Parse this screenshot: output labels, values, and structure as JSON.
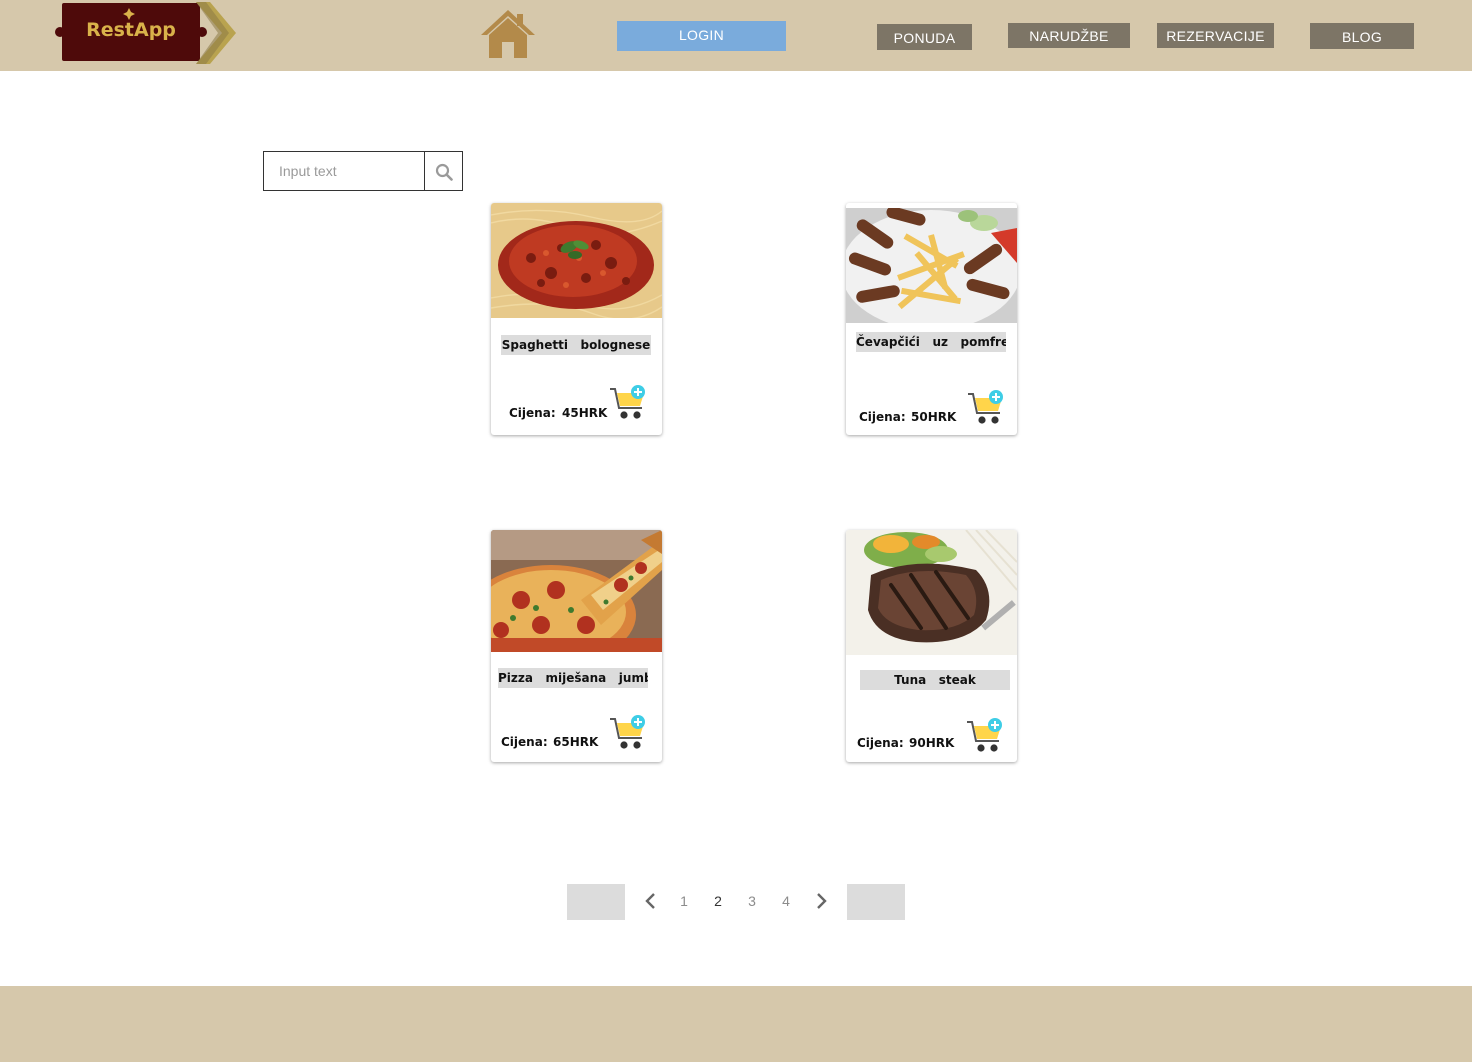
{
  "brand": {
    "name": "RestApp"
  },
  "header": {
    "login_label": "LOGIN",
    "nav": [
      "PONUDA",
      "NARUDŽBE",
      "REZERVACIJE",
      "BLOG"
    ]
  },
  "search": {
    "placeholder": "Input text"
  },
  "products": [
    {
      "name": "Spaghetti   bolognese",
      "price_label": "Cijena:",
      "price": "45HRK"
    },
    {
      "name": "Čevapčići   uz   pomfree",
      "price_label": "Cijena:",
      "price": "50HRK"
    },
    {
      "name": "Pizza   miješana   jumbo",
      "price_label": "Cijena:",
      "price": "65HRK"
    },
    {
      "name": "Tuna   steak",
      "price_label": "Cijena:",
      "price": "90HRK"
    }
  ],
  "pagination": {
    "pages": [
      "1",
      "2",
      "3",
      "4"
    ],
    "current": "2"
  },
  "colors": {
    "header_bg": "#d6c8ab",
    "login_bg": "#7aabdc",
    "nav_bg": "#7d7566",
    "logo_bg": "#4e0a0a",
    "logo_text": "#d9b24a",
    "cart_accent": "#ffd54a",
    "cart_plus": "#3ecde6"
  },
  "icons": [
    "home-icon",
    "search-icon",
    "cart-add-icon",
    "chevron-left-icon",
    "chevron-right-icon"
  ]
}
